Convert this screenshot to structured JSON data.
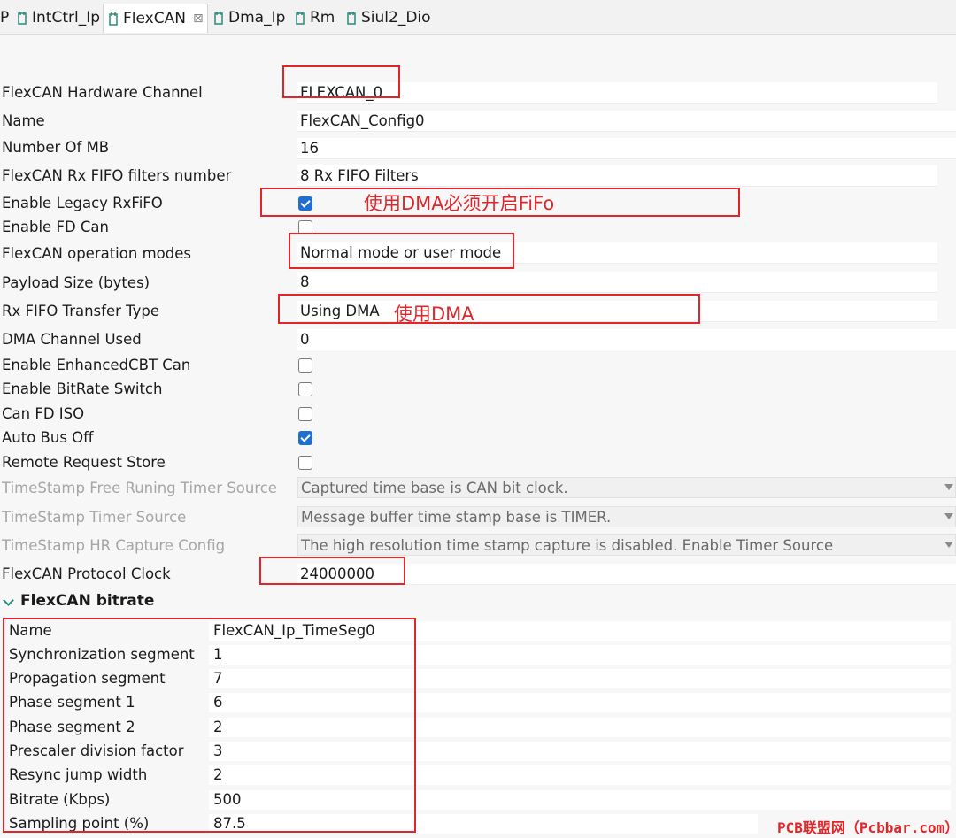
{
  "tabs": [
    {
      "label": "P",
      "icon": "none"
    },
    {
      "label": "IntCtrl_Ip",
      "icon": "plugin-icon"
    },
    {
      "label": "FlexCAN",
      "icon": "plugin-icon",
      "close": "⊠"
    },
    {
      "label": "Dma_Ip",
      "icon": "plugin-icon"
    },
    {
      "label": "Rm",
      "icon": "plugin-icon"
    },
    {
      "label": "Siul2_Dio",
      "icon": "plugin-icon"
    }
  ],
  "properties": [
    {
      "label": "FlexCAN Hardware Channel",
      "value": "FLEXCAN_0"
    },
    {
      "label": "Name",
      "value": "FlexCAN_Config0"
    },
    {
      "label": "Number Of MB",
      "value": "16"
    },
    {
      "label": "FlexCAN Rx FIFO filters number",
      "value": "8 Rx FIFO Filters"
    },
    {
      "label": "Enable Legacy RxFiFO",
      "checked": true
    },
    {
      "label": "Enable FD Can",
      "checked": false
    },
    {
      "label": "FlexCAN operation modes",
      "value": "Normal mode or user mode"
    },
    {
      "label": "Payload Size (bytes)",
      "value": "8"
    },
    {
      "label": "Rx FIFO Transfer Type",
      "value": "Using DMA"
    },
    {
      "label": "DMA Channel Used",
      "value": "0"
    },
    {
      "label": "Enable EnhancedCBT Can",
      "checked": false
    },
    {
      "label": "Enable BitRate Switch",
      "checked": false
    },
    {
      "label": "Can FD ISO",
      "checked": false
    },
    {
      "label": "Auto Bus Off",
      "checked": true
    },
    {
      "label": "Remote Request Store",
      "checked": false
    },
    {
      "label": "TimeStamp Free Runing Timer Source",
      "value": "Captured time base is CAN bit clock.",
      "disabled": true
    },
    {
      "label": "TimeStamp Timer Source",
      "value": "Message buffer time stamp base is TIMER.",
      "disabled": true
    },
    {
      "label": "TimeStamp HR Capture Config",
      "value": "The high resolution time stamp capture is disabled. Enable Timer Source",
      "disabled": true
    },
    {
      "label": "FlexCAN Protocol Clock",
      "value": "24000000"
    }
  ],
  "annotations": {
    "fifo": "使用DMA必须开启FiFo",
    "dma": "使用DMA"
  },
  "bitrate": {
    "title": "FlexCAN bitrate",
    "rows": [
      {
        "label": "Name",
        "value": "FlexCAN_Ip_TimeSeg0"
      },
      {
        "label": "Synchronization segment",
        "value": "1"
      },
      {
        "label": "Propagation segment",
        "value": "7"
      },
      {
        "label": "Phase segment 1",
        "value": "6"
      },
      {
        "label": "Phase segment 2",
        "value": "2"
      },
      {
        "label": "Prescaler division factor",
        "value": "3"
      },
      {
        "label": "Resync jump width",
        "value": "2"
      },
      {
        "label": "Bitrate (Kbps)",
        "value": "500"
      },
      {
        "label": "Sampling point (%)",
        "value": "87.5"
      }
    ]
  },
  "watermark": "PCB联盟网（Pcbbar.com）",
  "colors": {
    "highlight": "#e0262b",
    "checkbox": "#1f6fd1"
  }
}
